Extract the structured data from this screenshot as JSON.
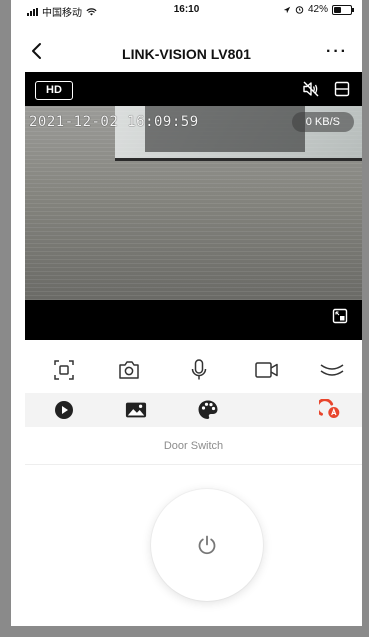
{
  "status_bar": {
    "carrier": "中国移动",
    "time": "16:10",
    "battery": "42%",
    "battery_level": 0.42,
    "icons": [
      "signal-icon",
      "wifi-icon",
      "location-icon",
      "alarm-icon",
      "battery-icon"
    ]
  },
  "nav": {
    "title": "LINK-VISION LV801",
    "back_icon": "chevron-left-icon",
    "more_icon": "more-dots-icon",
    "more_text": "···"
  },
  "player": {
    "quality_label": "HD",
    "timestamp": "2021-12-02 16:09:59",
    "speed": "0 KB/S",
    "top_icons": [
      "mute-icon",
      "layout-icon"
    ],
    "bottom_icon": "picture-in-picture-icon"
  },
  "toolbar": {
    "items": [
      "screen-record-icon",
      "camera-icon",
      "microphone-icon",
      "video-icon",
      "collapse-icon"
    ]
  },
  "feature_tabs": {
    "items": [
      "playback-icon",
      "gallery-icon",
      "theme-icon",
      "door-switch-icon"
    ],
    "active_color": "#e8452c"
  },
  "door_switch": {
    "label": "Door Switch",
    "power_icon": "power-icon",
    "icon_color": "#777777"
  }
}
